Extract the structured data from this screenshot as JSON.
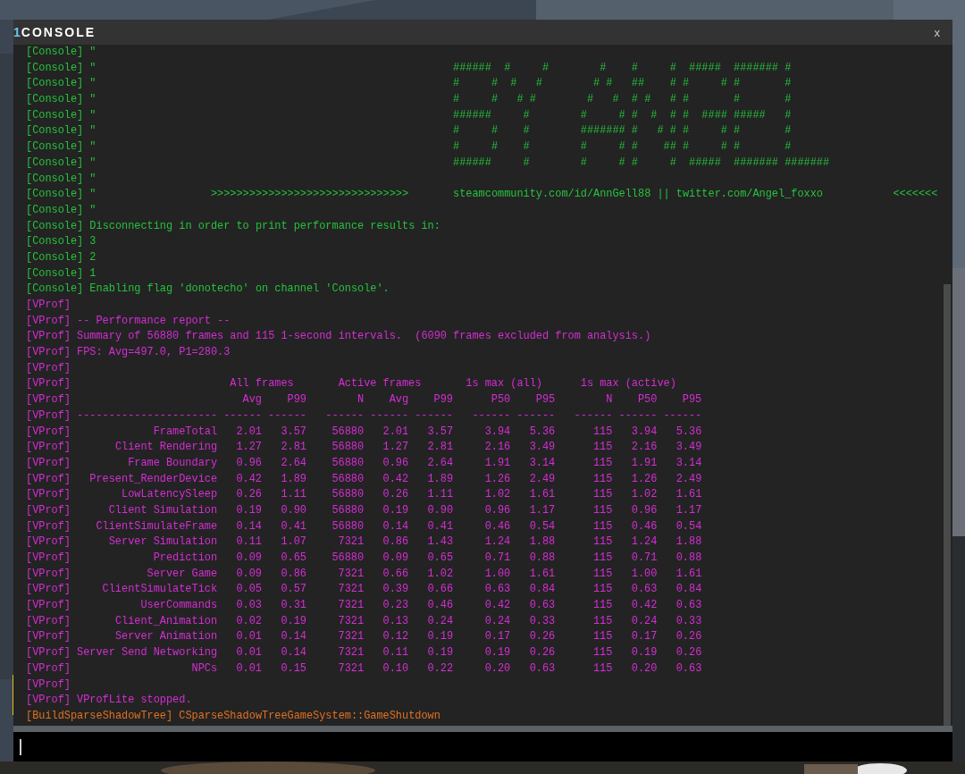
{
  "window": {
    "badge": "1",
    "title": "CONSOLE",
    "close": "x"
  },
  "log": [
    {
      "kind": "text",
      "tag": "[Console]",
      "color": "#25c23c",
      "text": "\""
    },
    {
      "kind": "art",
      "tag": "[Console]",
      "color": "#25c23c",
      "text": "\"",
      "art": "######  #     #        #    #     #  #####  ####### #"
    },
    {
      "kind": "art",
      "tag": "[Console]",
      "color": "#25c23c",
      "text": "\"",
      "art": "#     #  #   #        # #   ##    # #     # #       #"
    },
    {
      "kind": "art",
      "tag": "[Console]",
      "color": "#25c23c",
      "text": "\"",
      "art": "#     #   # #        #   #  # #   # #       #       #"
    },
    {
      "kind": "art",
      "tag": "[Console]",
      "color": "#25c23c",
      "text": "\"",
      "art": "######     #        #     # #  #  # #  #### #####   #"
    },
    {
      "kind": "art",
      "tag": "[Console]",
      "color": "#25c23c",
      "text": "\"",
      "art": "#     #    #        ####### #   # # #     # #       #"
    },
    {
      "kind": "art",
      "tag": "[Console]",
      "color": "#25c23c",
      "text": "\"",
      "art": "#     #    #        #     # #    ## #     # #       #"
    },
    {
      "kind": "art",
      "tag": "[Console]",
      "color": "#25c23c",
      "text": "\"",
      "art": "######     #        #     # #     #  #####  ####### #######"
    },
    {
      "kind": "text",
      "tag": "[Console]",
      "color": "#25c23c",
      "text": "\""
    },
    {
      "kind": "banner",
      "tag": "[Console]",
      "color": "#25c23c",
      "text": "\"",
      "arrows_right": ">>>>>>>>>>>>>>>>>>>>>>>>>>>>>>>",
      "links": "steamcommunity.com/id/AnnGell88 || twitter.com/Angel_foxxo",
      "arrows_left": "<<<<<<<"
    },
    {
      "kind": "text",
      "tag": "[Console]",
      "color": "#25c23c",
      "text": "\""
    },
    {
      "kind": "text",
      "tag": "[Console]",
      "color": "#25c23c",
      "text": "Disconnecting in order to print performance results in:"
    },
    {
      "kind": "text",
      "tag": "[Console]",
      "color": "#25c23c",
      "text": "3"
    },
    {
      "kind": "text",
      "tag": "[Console]",
      "color": "#25c23c",
      "text": "2"
    },
    {
      "kind": "text",
      "tag": "[Console]",
      "color": "#25c23c",
      "text": "1"
    },
    {
      "kind": "text",
      "tag": "[Console]",
      "color": "#25c23c",
      "text": "Enabling flag 'donotecho' on channel 'Console'."
    },
    {
      "kind": "text",
      "tag": "[VProf]",
      "color": "#d42ed4"
    },
    {
      "kind": "text",
      "tag": "[VProf]",
      "color": "#d42ed4",
      "text": "-- Performance report --"
    },
    {
      "kind": "text",
      "tag": "[VProf]",
      "color": "#d42ed4",
      "text": "Summary of 56880 frames and 115 1-second intervals.  (6090 frames excluded from analysis.)"
    },
    {
      "kind": "text",
      "tag": "[VProf]",
      "color": "#d42ed4",
      "text": "FPS: Avg=497.0, P1=280.3"
    },
    {
      "kind": "text",
      "tag": "[VProf]",
      "color": "#d42ed4"
    },
    {
      "kind": "groups",
      "tag": "[VProf]",
      "color": "#d42ed4",
      "groups": [
        "All frames",
        "Active frames",
        "1s max (all)",
        "1s max (active)"
      ]
    },
    {
      "kind": "header",
      "tag": "[VProf]",
      "color": "#d42ed4",
      "cells": [
        "Avg",
        "P99",
        "N",
        "Avg",
        "P99",
        "P50",
        "P95",
        "N",
        "P50",
        "P95"
      ]
    },
    {
      "kind": "rule",
      "tag": "[VProf]",
      "color": "#d42ed4",
      "label": "----------------------",
      "cells": [
        "------",
        "------",
        "------",
        "------",
        "------",
        "------",
        "------",
        "------",
        "------",
        "------"
      ]
    },
    {
      "kind": "row",
      "tag": "[VProf]",
      "color": "#d42ed4",
      "label": "FrameTotal",
      "cells": [
        "2.01",
        "3.57",
        "56880",
        "2.01",
        "3.57",
        "3.94",
        "5.36",
        "115",
        "3.94",
        "5.36"
      ]
    },
    {
      "kind": "row",
      "tag": "[VProf]",
      "color": "#d42ed4",
      "label": "Client Rendering",
      "cells": [
        "1.27",
        "2.81",
        "56880",
        "1.27",
        "2.81",
        "2.16",
        "3.49",
        "115",
        "2.16",
        "3.49"
      ]
    },
    {
      "kind": "row",
      "tag": "[VProf]",
      "color": "#d42ed4",
      "label": "Frame Boundary",
      "cells": [
        "0.96",
        "2.64",
        "56880",
        "0.96",
        "2.64",
        "1.91",
        "3.14",
        "115",
        "1.91",
        "3.14"
      ]
    },
    {
      "kind": "row",
      "tag": "[VProf]",
      "color": "#d42ed4",
      "label": "Present_RenderDevice",
      "cells": [
        "0.42",
        "1.89",
        "56880",
        "0.42",
        "1.89",
        "1.26",
        "2.49",
        "115",
        "1.26",
        "2.49"
      ]
    },
    {
      "kind": "row",
      "tag": "[VProf]",
      "color": "#d42ed4",
      "label": "LowLatencySleep",
      "cells": [
        "0.26",
        "1.11",
        "56880",
        "0.26",
        "1.11",
        "1.02",
        "1.61",
        "115",
        "1.02",
        "1.61"
      ]
    },
    {
      "kind": "row",
      "tag": "[VProf]",
      "color": "#d42ed4",
      "label": "Client Simulation",
      "cells": [
        "0.19",
        "0.90",
        "56880",
        "0.19",
        "0.90",
        "0.96",
        "1.17",
        "115",
        "0.96",
        "1.17"
      ]
    },
    {
      "kind": "row",
      "tag": "[VProf]",
      "color": "#d42ed4",
      "label": "ClientSimulateFrame",
      "cells": [
        "0.14",
        "0.41",
        "56880",
        "0.14",
        "0.41",
        "0.46",
        "0.54",
        "115",
        "0.46",
        "0.54"
      ]
    },
    {
      "kind": "row",
      "tag": "[VProf]",
      "color": "#d42ed4",
      "label": "Server Simulation",
      "cells": [
        "0.11",
        "1.07",
        "7321",
        "0.86",
        "1.43",
        "1.24",
        "1.88",
        "115",
        "1.24",
        "1.88"
      ]
    },
    {
      "kind": "row",
      "tag": "[VProf]",
      "color": "#d42ed4",
      "label": "Prediction",
      "cells": [
        "0.09",
        "0.65",
        "56880",
        "0.09",
        "0.65",
        "0.71",
        "0.88",
        "115",
        "0.71",
        "0.88"
      ]
    },
    {
      "kind": "row",
      "tag": "[VProf]",
      "color": "#d42ed4",
      "label": "Server Game",
      "cells": [
        "0.09",
        "0.86",
        "7321",
        "0.66",
        "1.02",
        "1.00",
        "1.61",
        "115",
        "1.00",
        "1.61"
      ]
    },
    {
      "kind": "row",
      "tag": "[VProf]",
      "color": "#d42ed4",
      "label": "ClientSimulateTick",
      "cells": [
        "0.05",
        "0.57",
        "7321",
        "0.39",
        "0.66",
        "0.63",
        "0.84",
        "115",
        "0.63",
        "0.84"
      ]
    },
    {
      "kind": "row",
      "tag": "[VProf]",
      "color": "#d42ed4",
      "label": "UserCommands",
      "cells": [
        "0.03",
        "0.31",
        "7321",
        "0.23",
        "0.46",
        "0.42",
        "0.63",
        "115",
        "0.42",
        "0.63"
      ]
    },
    {
      "kind": "row",
      "tag": "[VProf]",
      "color": "#d42ed4",
      "label": "Client_Animation",
      "cells": [
        "0.02",
        "0.19",
        "7321",
        "0.13",
        "0.24",
        "0.24",
        "0.33",
        "115",
        "0.24",
        "0.33"
      ]
    },
    {
      "kind": "row",
      "tag": "[VProf]",
      "color": "#d42ed4",
      "label": "Server Animation",
      "cells": [
        "0.01",
        "0.14",
        "7321",
        "0.12",
        "0.19",
        "0.17",
        "0.26",
        "115",
        "0.17",
        "0.26"
      ]
    },
    {
      "kind": "row",
      "tag": "[VProf]",
      "color": "#d42ed4",
      "label": "Server Send Networking",
      "cells": [
        "0.01",
        "0.14",
        "7321",
        "0.11",
        "0.19",
        "0.19",
        "0.26",
        "115",
        "0.19",
        "0.26"
      ]
    },
    {
      "kind": "row",
      "tag": "[VProf]",
      "color": "#d42ed4",
      "label": "NPCs",
      "cells": [
        "0.01",
        "0.15",
        "7321",
        "0.10",
        "0.22",
        "0.20",
        "0.63",
        "115",
        "0.20",
        "0.63"
      ]
    },
    {
      "kind": "text",
      "tag": "[VProf]",
      "color": "#d42ed4"
    },
    {
      "kind": "text",
      "tag": "[VProf]",
      "color": "#d42ed4",
      "text": "VProfLite stopped."
    },
    {
      "kind": "text",
      "tag": "[BuildSparseShadowTree]",
      "color": "#e2701e",
      "text": "CSparseShadowTreeGameSystem::GameShutdown"
    }
  ]
}
